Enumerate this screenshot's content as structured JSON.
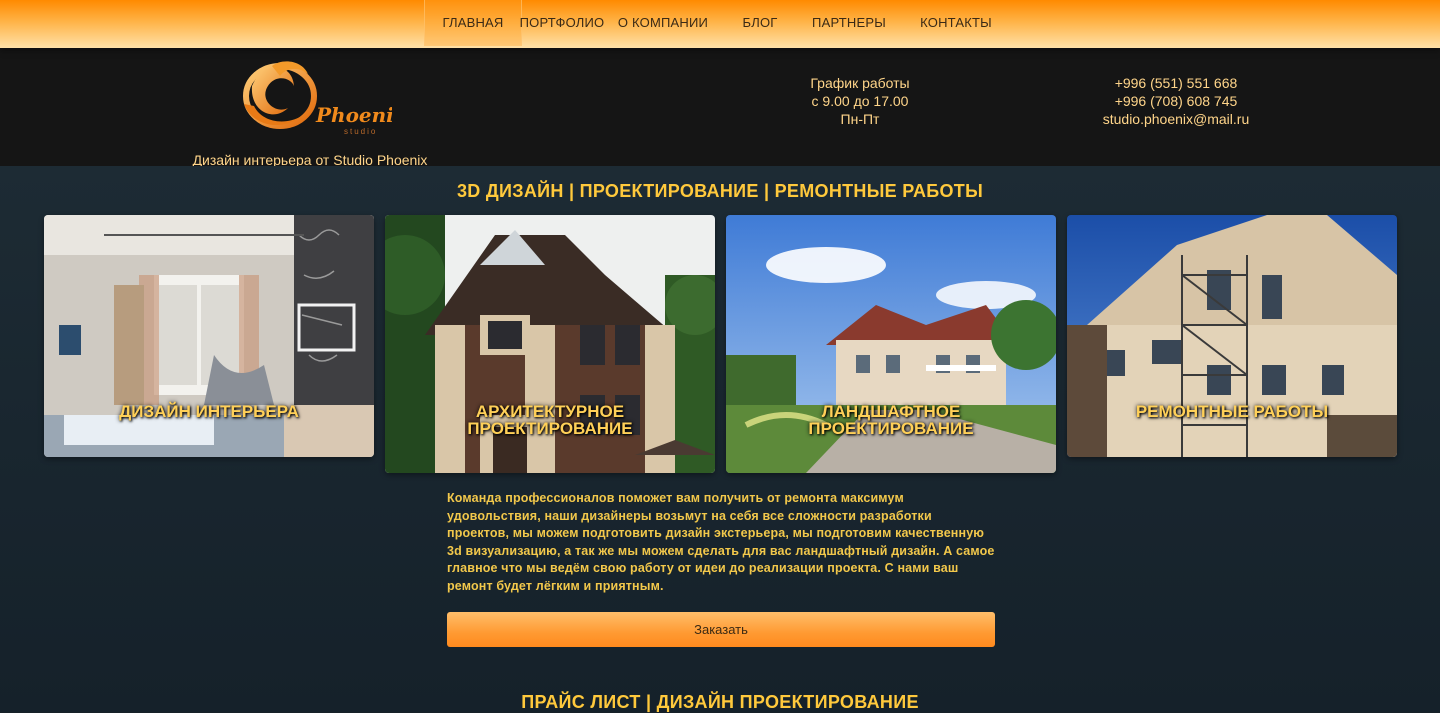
{
  "nav": {
    "items": [
      "Главная",
      "Портфолио",
      "О компании",
      "Блог",
      "Партнеры",
      "Контакты"
    ]
  },
  "header": {
    "logo_text": "Phoenix",
    "logo_sub": "studio",
    "tagline": "Дизайн интерьера от Studio Phoenix",
    "schedule": [
      "График работы",
      "с 9.00 до 17.00",
      "Пн-Пт"
    ],
    "contacts": [
      "+996 (551) 551 668",
      "+996 (708) 608 745",
      "studio.phoenix@mail.ru"
    ]
  },
  "main": {
    "title": "3D ДИЗАЙН | ПРОЕКТИРОВАНИЕ | РЕМОНТНЫЕ РАБОТЫ",
    "cards": [
      {
        "label": "Дизайн интерьера"
      },
      {
        "label_line1": "Архитектурное",
        "label_line2": "проектирование"
      },
      {
        "label_line1": "Ландшафтное",
        "label_line2": "проектирование"
      },
      {
        "label": "Ремонтные работы"
      }
    ],
    "description": "Команда профессионалов поможет вам получить от ремонта максимум удовольствия, наши дизайнеры возьмут на себя все сложности разработки проектов, мы можем подготовить дизайн экстерьера, мы подготовим качественную 3d визуализацию, а так же мы можем сделать для вас ландшафтный дизайн. А самое главное что мы ведём свою работу от идеи до реализации проекта. С нами ваш ремонт будет лёгким и приятным.",
    "order_button": "Заказать"
  },
  "price": {
    "title": "ПРАЙС ЛИСТ | ДИЗАЙН ПРОЕКТИРОВАНИЕ"
  },
  "colors": {
    "accent": "#ffc93c",
    "nav_orange": "#ff8a00",
    "background": "#172128"
  }
}
